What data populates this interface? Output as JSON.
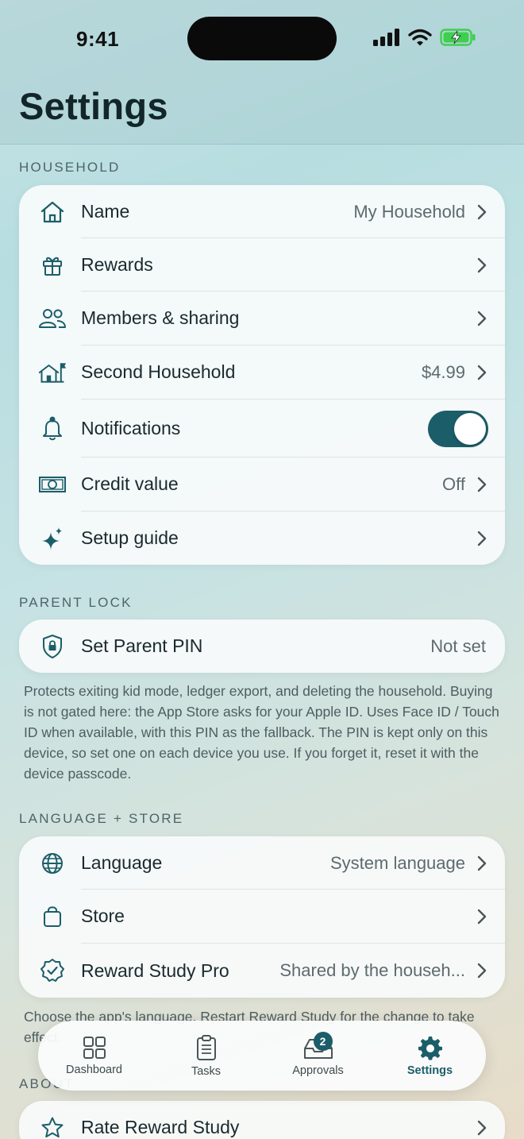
{
  "status_bar": {
    "time": "9:41"
  },
  "page_title": "Settings",
  "household": {
    "header": "HOUSEHOLD",
    "rows": [
      {
        "label": "Name",
        "value": "My Household",
        "icon": "house-icon"
      },
      {
        "label": "Rewards",
        "value": "",
        "icon": "gift-icon"
      },
      {
        "label": "Members & sharing",
        "value": "",
        "icon": "people-icon"
      },
      {
        "label": "Second Household",
        "value": "$4.99",
        "icon": "house-flag-icon"
      },
      {
        "label": "Notifications",
        "value": "",
        "icon": "bell-icon",
        "toggle": true
      },
      {
        "label": "Credit value",
        "value": "Off",
        "icon": "banknote-icon"
      },
      {
        "label": "Setup guide",
        "value": "",
        "icon": "sparkles-icon"
      }
    ]
  },
  "parent_lock": {
    "header": "PARENT LOCK",
    "row": {
      "label": "Set Parent PIN",
      "value": "Not set",
      "icon": "lock-shield-icon"
    },
    "footnote": "Protects exiting kid mode, ledger export, and deleting the household. Buying is not gated here: the App Store asks for your Apple ID. Uses Face ID / Touch ID when available, with this PIN as the fallback. The PIN is kept only on this device, so set one on each device you use. If you forget it, reset it with the device passcode."
  },
  "language_store": {
    "header": "LANGUAGE + STORE",
    "rows": [
      {
        "label": "Language",
        "value": "System language",
        "icon": "globe-icon"
      },
      {
        "label": "Store",
        "value": "",
        "icon": "bag-icon"
      },
      {
        "label": "Reward Study Pro",
        "value": "Shared by the househ...",
        "icon": "checkmark-seal-icon"
      }
    ],
    "footnote": "Choose the app's language. Restart Reward Study for the change to take effect."
  },
  "about": {
    "header": "ABOUT",
    "rows": [
      {
        "label": "Rate Reward Study",
        "value": "",
        "icon": "star-icon"
      }
    ]
  },
  "tab_bar": {
    "tabs": [
      {
        "label": "Dashboard",
        "icon": "grid-icon"
      },
      {
        "label": "Tasks",
        "icon": "clipboard-list-icon"
      },
      {
        "label": "Approvals",
        "icon": "tray-icon",
        "badge": "2"
      },
      {
        "label": "Settings",
        "icon": "gear-icon",
        "active": true
      }
    ]
  },
  "colors": {
    "accent": "#1b5e69",
    "text": "#1a2a2e",
    "secondary_text": "#5d6b6d"
  }
}
